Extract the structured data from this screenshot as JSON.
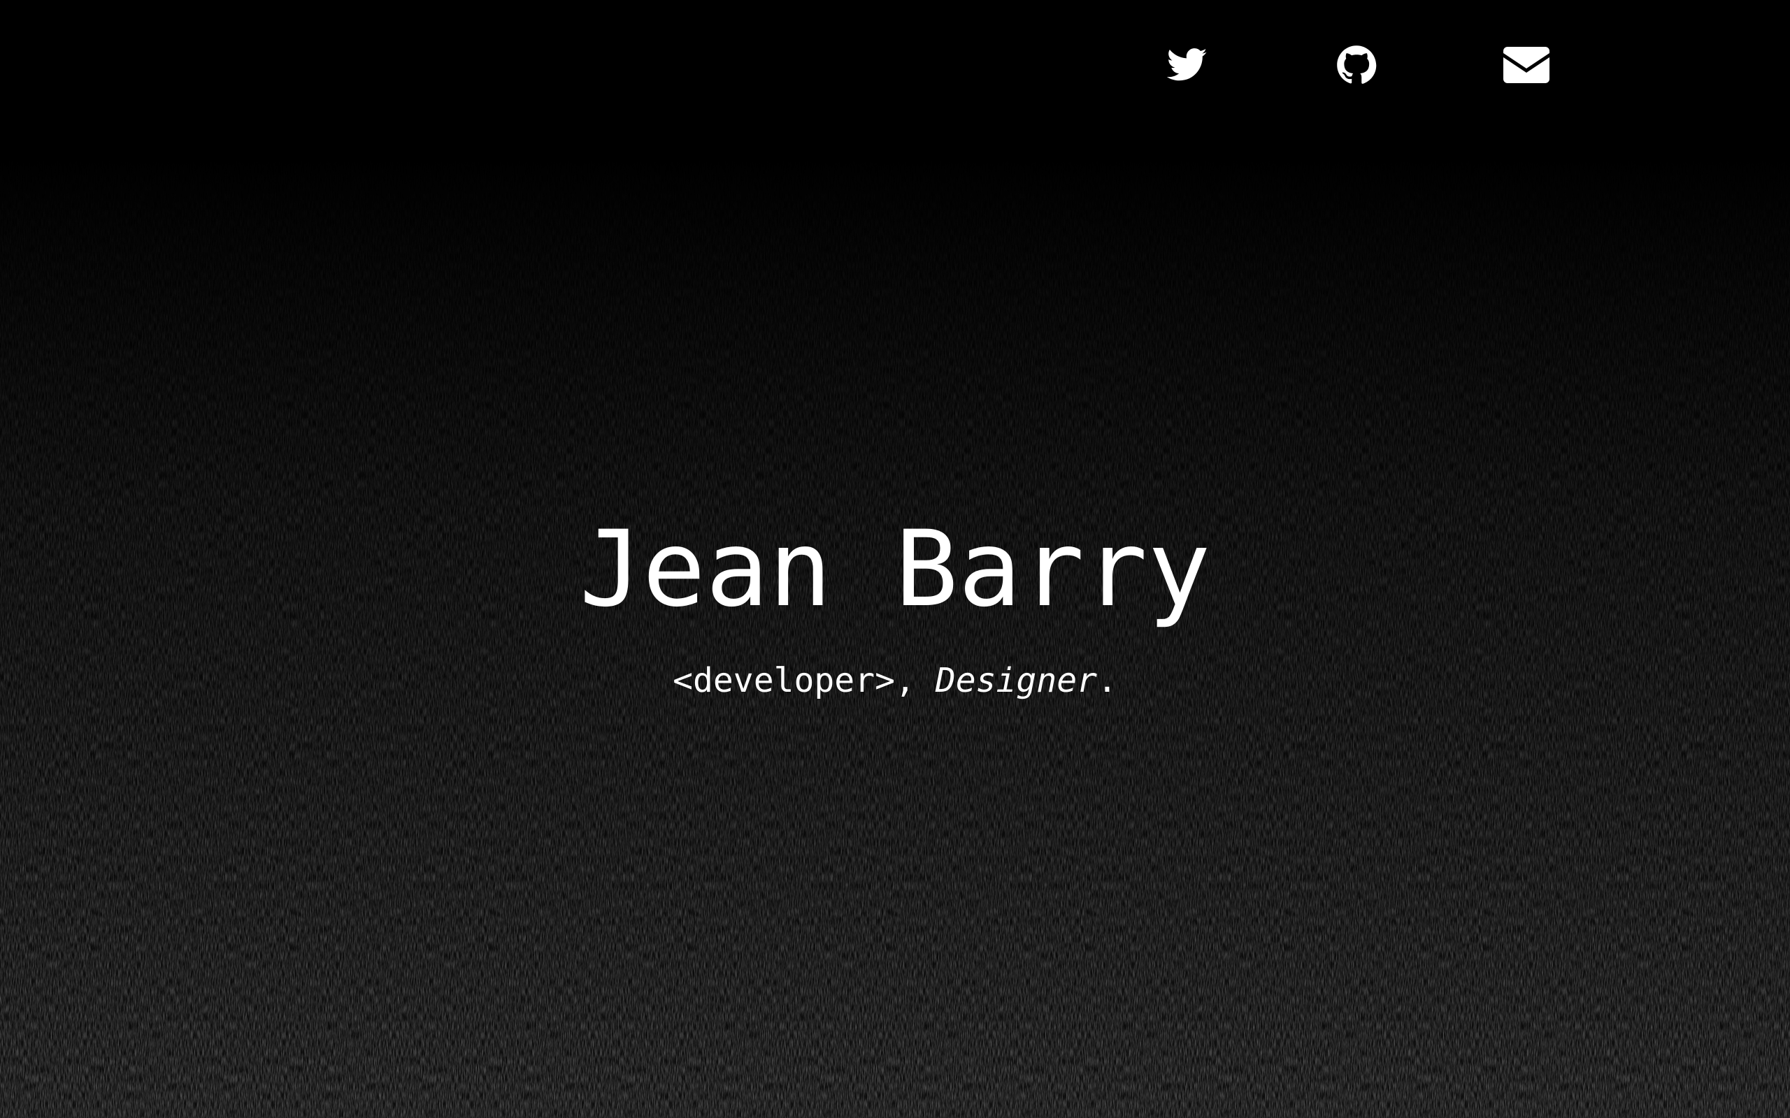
{
  "nav": {
    "links": [
      {
        "icon": "twitter-icon",
        "label": "Twitter"
      },
      {
        "icon": "github-icon",
        "label": "GitHub"
      },
      {
        "icon": "envelope-icon",
        "label": "Email"
      }
    ]
  },
  "hero": {
    "name": "Jean Barry",
    "role_code": "<developer>",
    "separator": ", ",
    "role_em": "Designer",
    "suffix": "."
  },
  "colors": {
    "background": "#000000",
    "text": "#ffffff"
  }
}
